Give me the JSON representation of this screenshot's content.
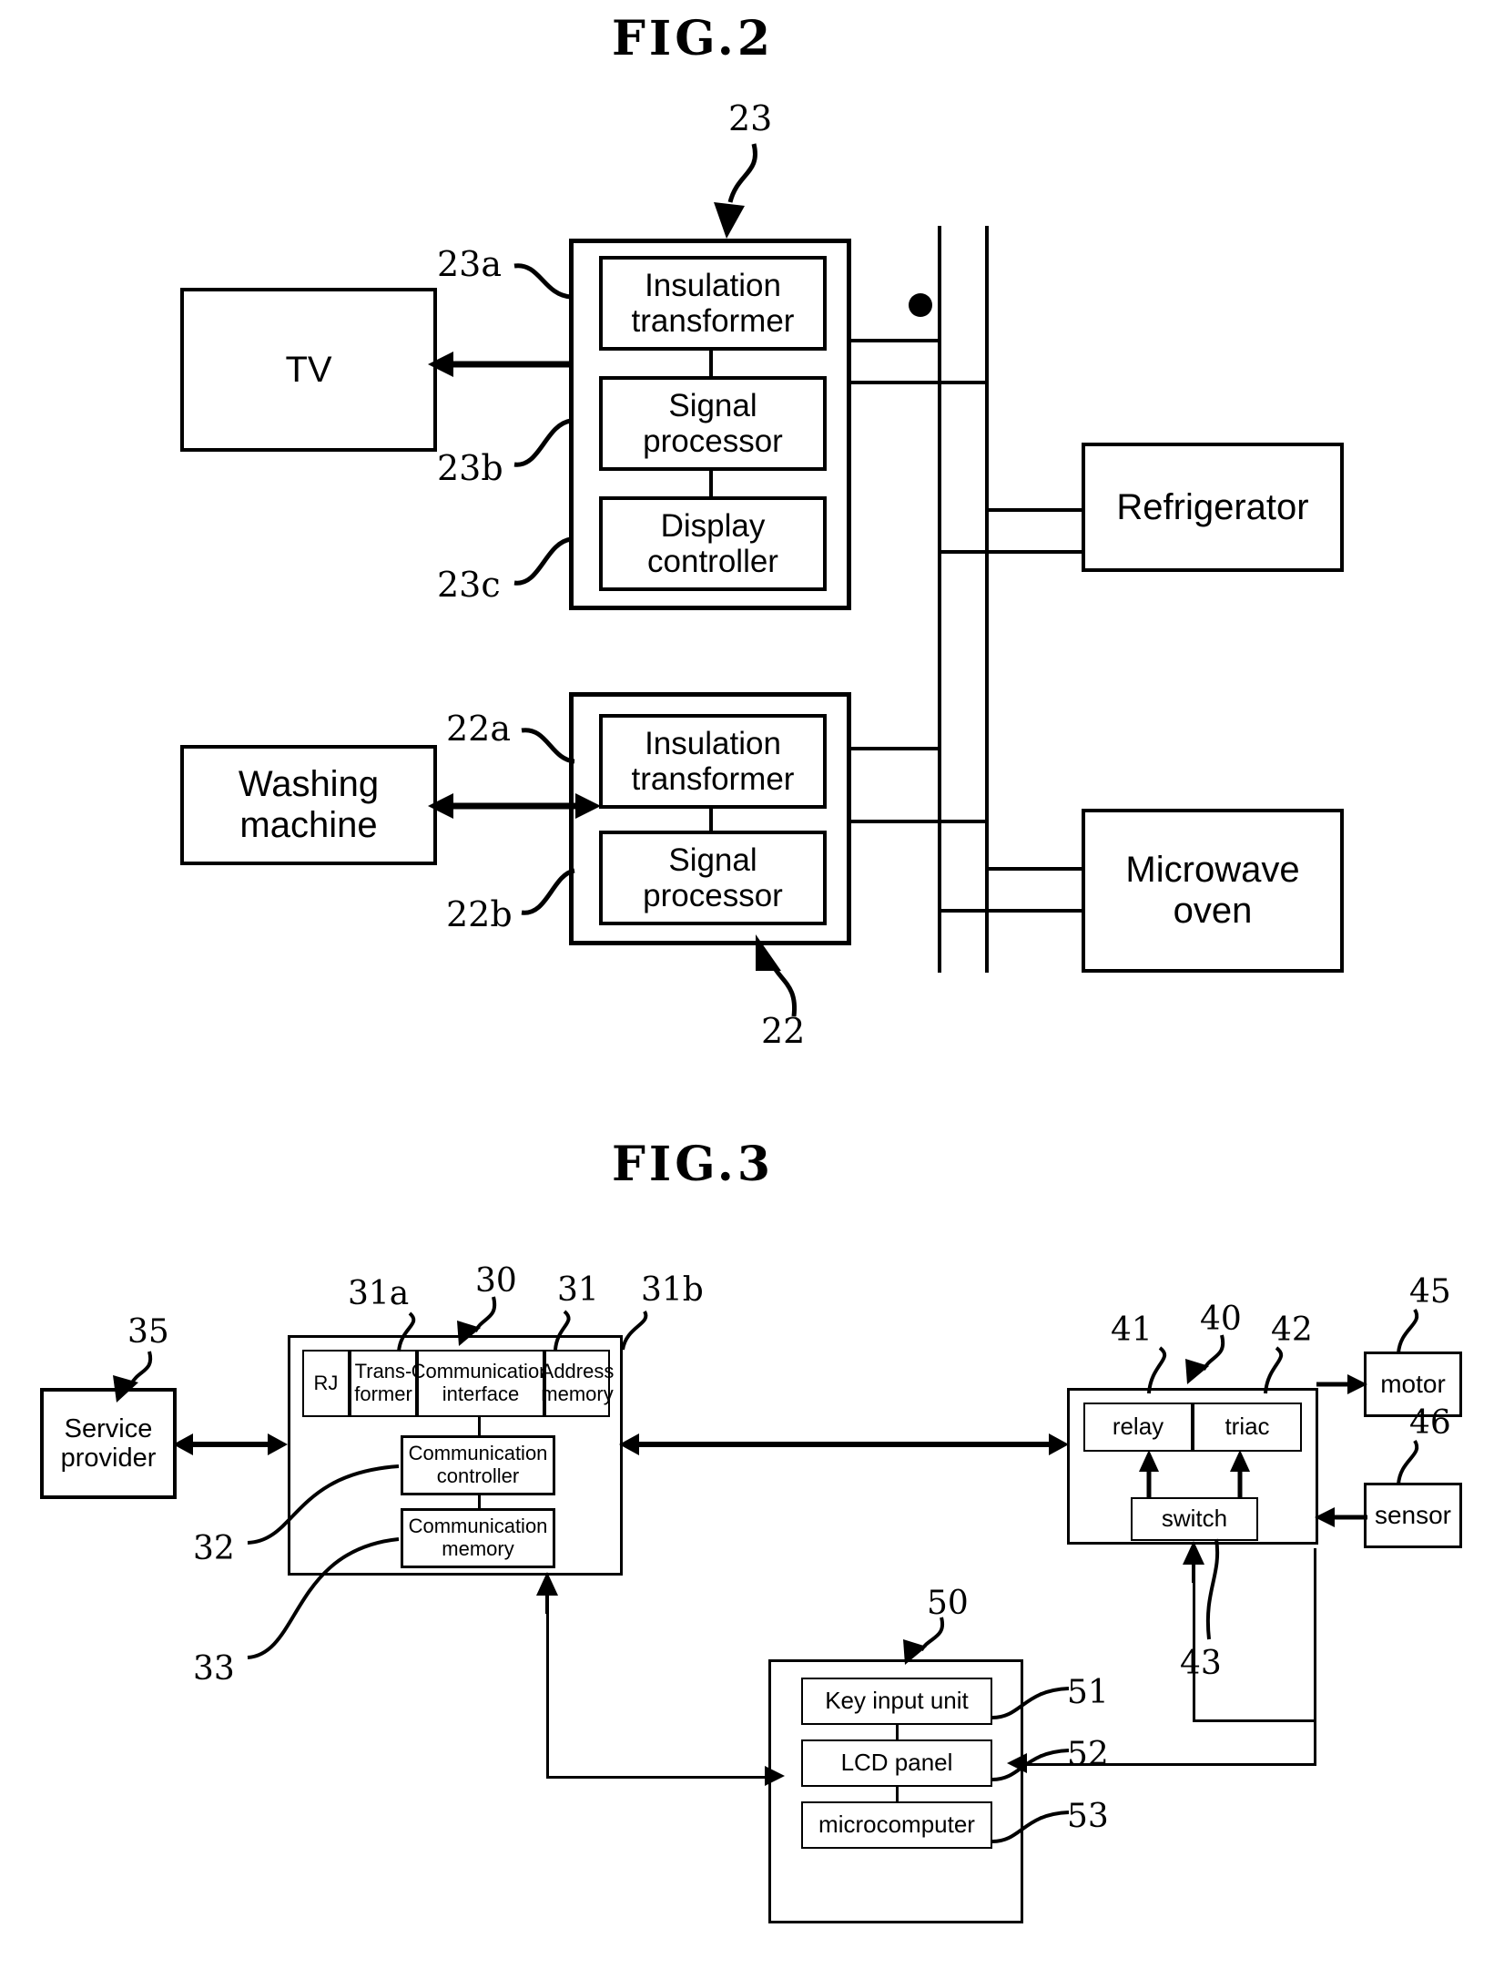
{
  "figures": [
    {
      "id": "fig2",
      "title": "FIG.2",
      "blocks": {
        "tv": "TV",
        "washing_machine": "Washing machine",
        "refrigerator": "Refrigerator",
        "microwave_oven": "Microwave oven",
        "insulation_transformer_23a": "Insulation transformer",
        "signal_processor_23b": "Signal processor",
        "display_controller_23c": "Display controller",
        "insulation_transformer_22a": "Insulation transformer",
        "signal_processor_22b": "Signal processor"
      },
      "reference_numerals": {
        "module_23": "23",
        "insulation_transformer": "23a",
        "signal_processor": "23b",
        "display_controller": "23c",
        "module_22": "22",
        "insulation_transformer_w": "22a",
        "signal_processor_w": "22b"
      }
    },
    {
      "id": "fig3",
      "title": "FIG.3",
      "blocks": {
        "service_provider": "Service provider",
        "rj": "RJ",
        "transformer": "Trans- former",
        "communication_interface": "Communication interface",
        "address_memory": "Address memory",
        "communication_controller": "Communication controller",
        "communication_memory": "Communication memory",
        "relay": "relay",
        "triac": "triac",
        "switch": "switch",
        "motor": "motor",
        "sensor": "sensor",
        "key_input_unit": "Key input unit",
        "lcd_panel": "LCD panel",
        "microcomputer": "microcomputer"
      },
      "reference_numerals": {
        "service_provider": "35",
        "transformer": "31a",
        "communication_module": "30",
        "communication_interface": "31",
        "address_memory": "31b",
        "communication_controller": "32",
        "communication_memory": "33",
        "relay": "41",
        "driving_unit": "40",
        "triac": "42",
        "switch": "43",
        "motor": "45",
        "sensor": "46",
        "display_unit": "50",
        "key_input_unit": "51",
        "lcd_panel": "52",
        "microcomputer": "53"
      }
    }
  ],
  "style": {
    "ink": "#000000",
    "paper": "#ffffff"
  }
}
